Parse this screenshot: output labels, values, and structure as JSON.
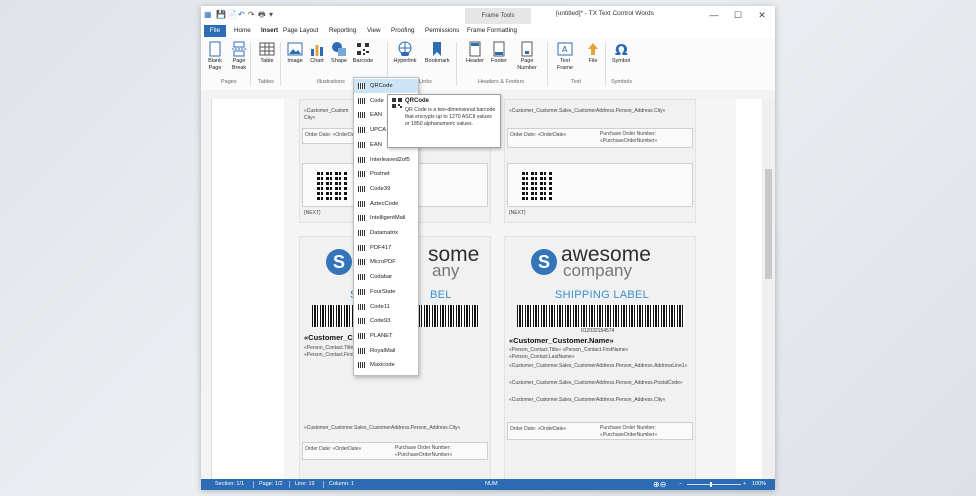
{
  "window": {
    "quick_access": [
      "💾",
      "📄",
      "↶",
      "↷",
      "🖶",
      "▾"
    ],
    "frame_tools": "Frame Tools",
    "title": "[untitled]* - TX Text Control Words",
    "controls": {
      "minimize": "—",
      "maximize": "☐",
      "close": "✕"
    }
  },
  "menu": {
    "file": "File",
    "tabs": [
      "Home",
      "Insert",
      "Page Layout",
      "Reporting",
      "View",
      "Proofing",
      "Permissions",
      "Frame Formatting"
    ]
  },
  "ribbon": {
    "buttons": [
      {
        "label": "Blank\nPage",
        "icon": "blank-page-icon"
      },
      {
        "label": "Page\nBreak",
        "icon": "page-break-icon"
      },
      {
        "label": "Table",
        "icon": "table-icon"
      },
      {
        "label": "Image",
        "icon": "image-icon"
      },
      {
        "label": "Chart",
        "icon": "chart-icon"
      },
      {
        "label": "Shape",
        "icon": "shape-icon"
      },
      {
        "label": "Barcode",
        "icon": "barcode-icon"
      },
      {
        "label": "Hyperlink",
        "icon": "hyperlink-icon"
      },
      {
        "label": "Bookmark",
        "icon": "bookmark-icon"
      },
      {
        "label": "Header",
        "icon": "header-icon"
      },
      {
        "label": "Footer",
        "icon": "footer-icon"
      },
      {
        "label": "Page\nNumber",
        "icon": "page-number-icon"
      },
      {
        "label": "Text\nFrame",
        "icon": "text-frame-icon"
      },
      {
        "label": "File",
        "icon": "file-icon"
      },
      {
        "label": "Symbol",
        "icon": "symbol-icon"
      }
    ],
    "groups": [
      "Pages",
      "Tables",
      "Illustrations",
      "Links",
      "Headers & Footers",
      "Text",
      "Symbols"
    ]
  },
  "barcode_menu": {
    "items": [
      "QRCode",
      "Code",
      "EAN",
      "UPCA",
      "EAN",
      "Interleaved2of5",
      "Postnet",
      "Code39",
      "AztecCode",
      "IntelligentMail",
      "Datamatrix",
      "PDF417",
      "MicroPDF",
      "Codabar",
      "FourState",
      "Code11",
      "Code93",
      "PLANET",
      "RoyalMail",
      "Maxicode"
    ],
    "selected": "QRCode"
  },
  "tooltip": {
    "title": "QRCode",
    "body": "QR Code is a two-dimensional barcode that encrypts up to 1270 ASCII values or 1850 alphanumeric values."
  },
  "labels": {
    "top": {
      "address": "«Customer_Customer.Sales_CustomerAddress.Person_Address.City»",
      "address_short": "«Customer_Custom",
      "city": "City»",
      "order_date": "Order Date: «OrderDate»",
      "po": "Purchase Order Number: «PurchaseOrderNumber»",
      "next": "{NEXT}"
    },
    "bottom": {
      "logo_word1": "awesome",
      "logo_word2": "company",
      "logo_partial1": "some",
      "logo_partial2": "any",
      "ship": "SHIPPING LABEL",
      "ship_partial_left": "SH",
      "ship_partial_right": "BEL",
      "barcode_number": "012032154574",
      "cust_name": "«Customer_Customer.Name»",
      "cust_name_partial": "«Customer_C",
      "contact1": "«Person_Contact.Title» «Person_Contact.FirstName»",
      "contact2": "«Person_Contact.LastName»",
      "addr1": "«Customer_Customer.Sales_CustomerAddress.Person_Address.AddressLine1»",
      "addr2": "«Customer_Customer.Sales_CustomerAddress.Person_Address.PostalCode»",
      "addr3": "«Customer_Customer.Sales_CustomerAddress.Person_Address.City»",
      "order_date": "Order Date: «OrderDate»",
      "po": "Purchase Order Number: «PurchaseOrderNumber»"
    }
  },
  "status": {
    "section": "Section: 1/1",
    "page": "Page: 1/2",
    "line": "Line: 19",
    "column": "Column: 1",
    "num": "NUM",
    "zoom": "100%"
  },
  "colors": {
    "accent": "#2b6cb4",
    "ship_label": "#3a8fd0",
    "logo_circle": "#3475b9"
  }
}
